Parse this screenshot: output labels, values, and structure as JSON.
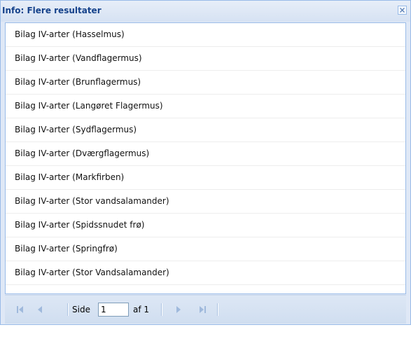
{
  "window": {
    "title": "Info: Flere resultater",
    "close_label": "×"
  },
  "results": [
    "Bilag IV-arter (Hasselmus)",
    "Bilag IV-arter (Vandflagermus)",
    "Bilag IV-arter (Brunflagermus)",
    "Bilag IV-arter (Langøret Flagermus)",
    "Bilag IV-arter (Sydflagermus)",
    "Bilag IV-arter (Dværgflagermus)",
    "Bilag IV-arter (Markfirben)",
    "Bilag IV-arter (Stor vandsalamander)",
    "Bilag IV-arter (Spidssnudet frø)",
    "Bilag IV-arter (Springfrø)",
    "Bilag IV-arter (Stor Vandsalamander)"
  ],
  "pager": {
    "page_label": "Side",
    "page_value": "1",
    "of_label": "af 1",
    "icons": {
      "first": "first-page-icon",
      "prev": "prev-page-icon",
      "next": "next-page-icon",
      "last": "last-page-icon"
    }
  },
  "colors": {
    "title_text": "#15428b",
    "border": "#99bbe8",
    "disabled_arrow": "#9fb9dc"
  }
}
